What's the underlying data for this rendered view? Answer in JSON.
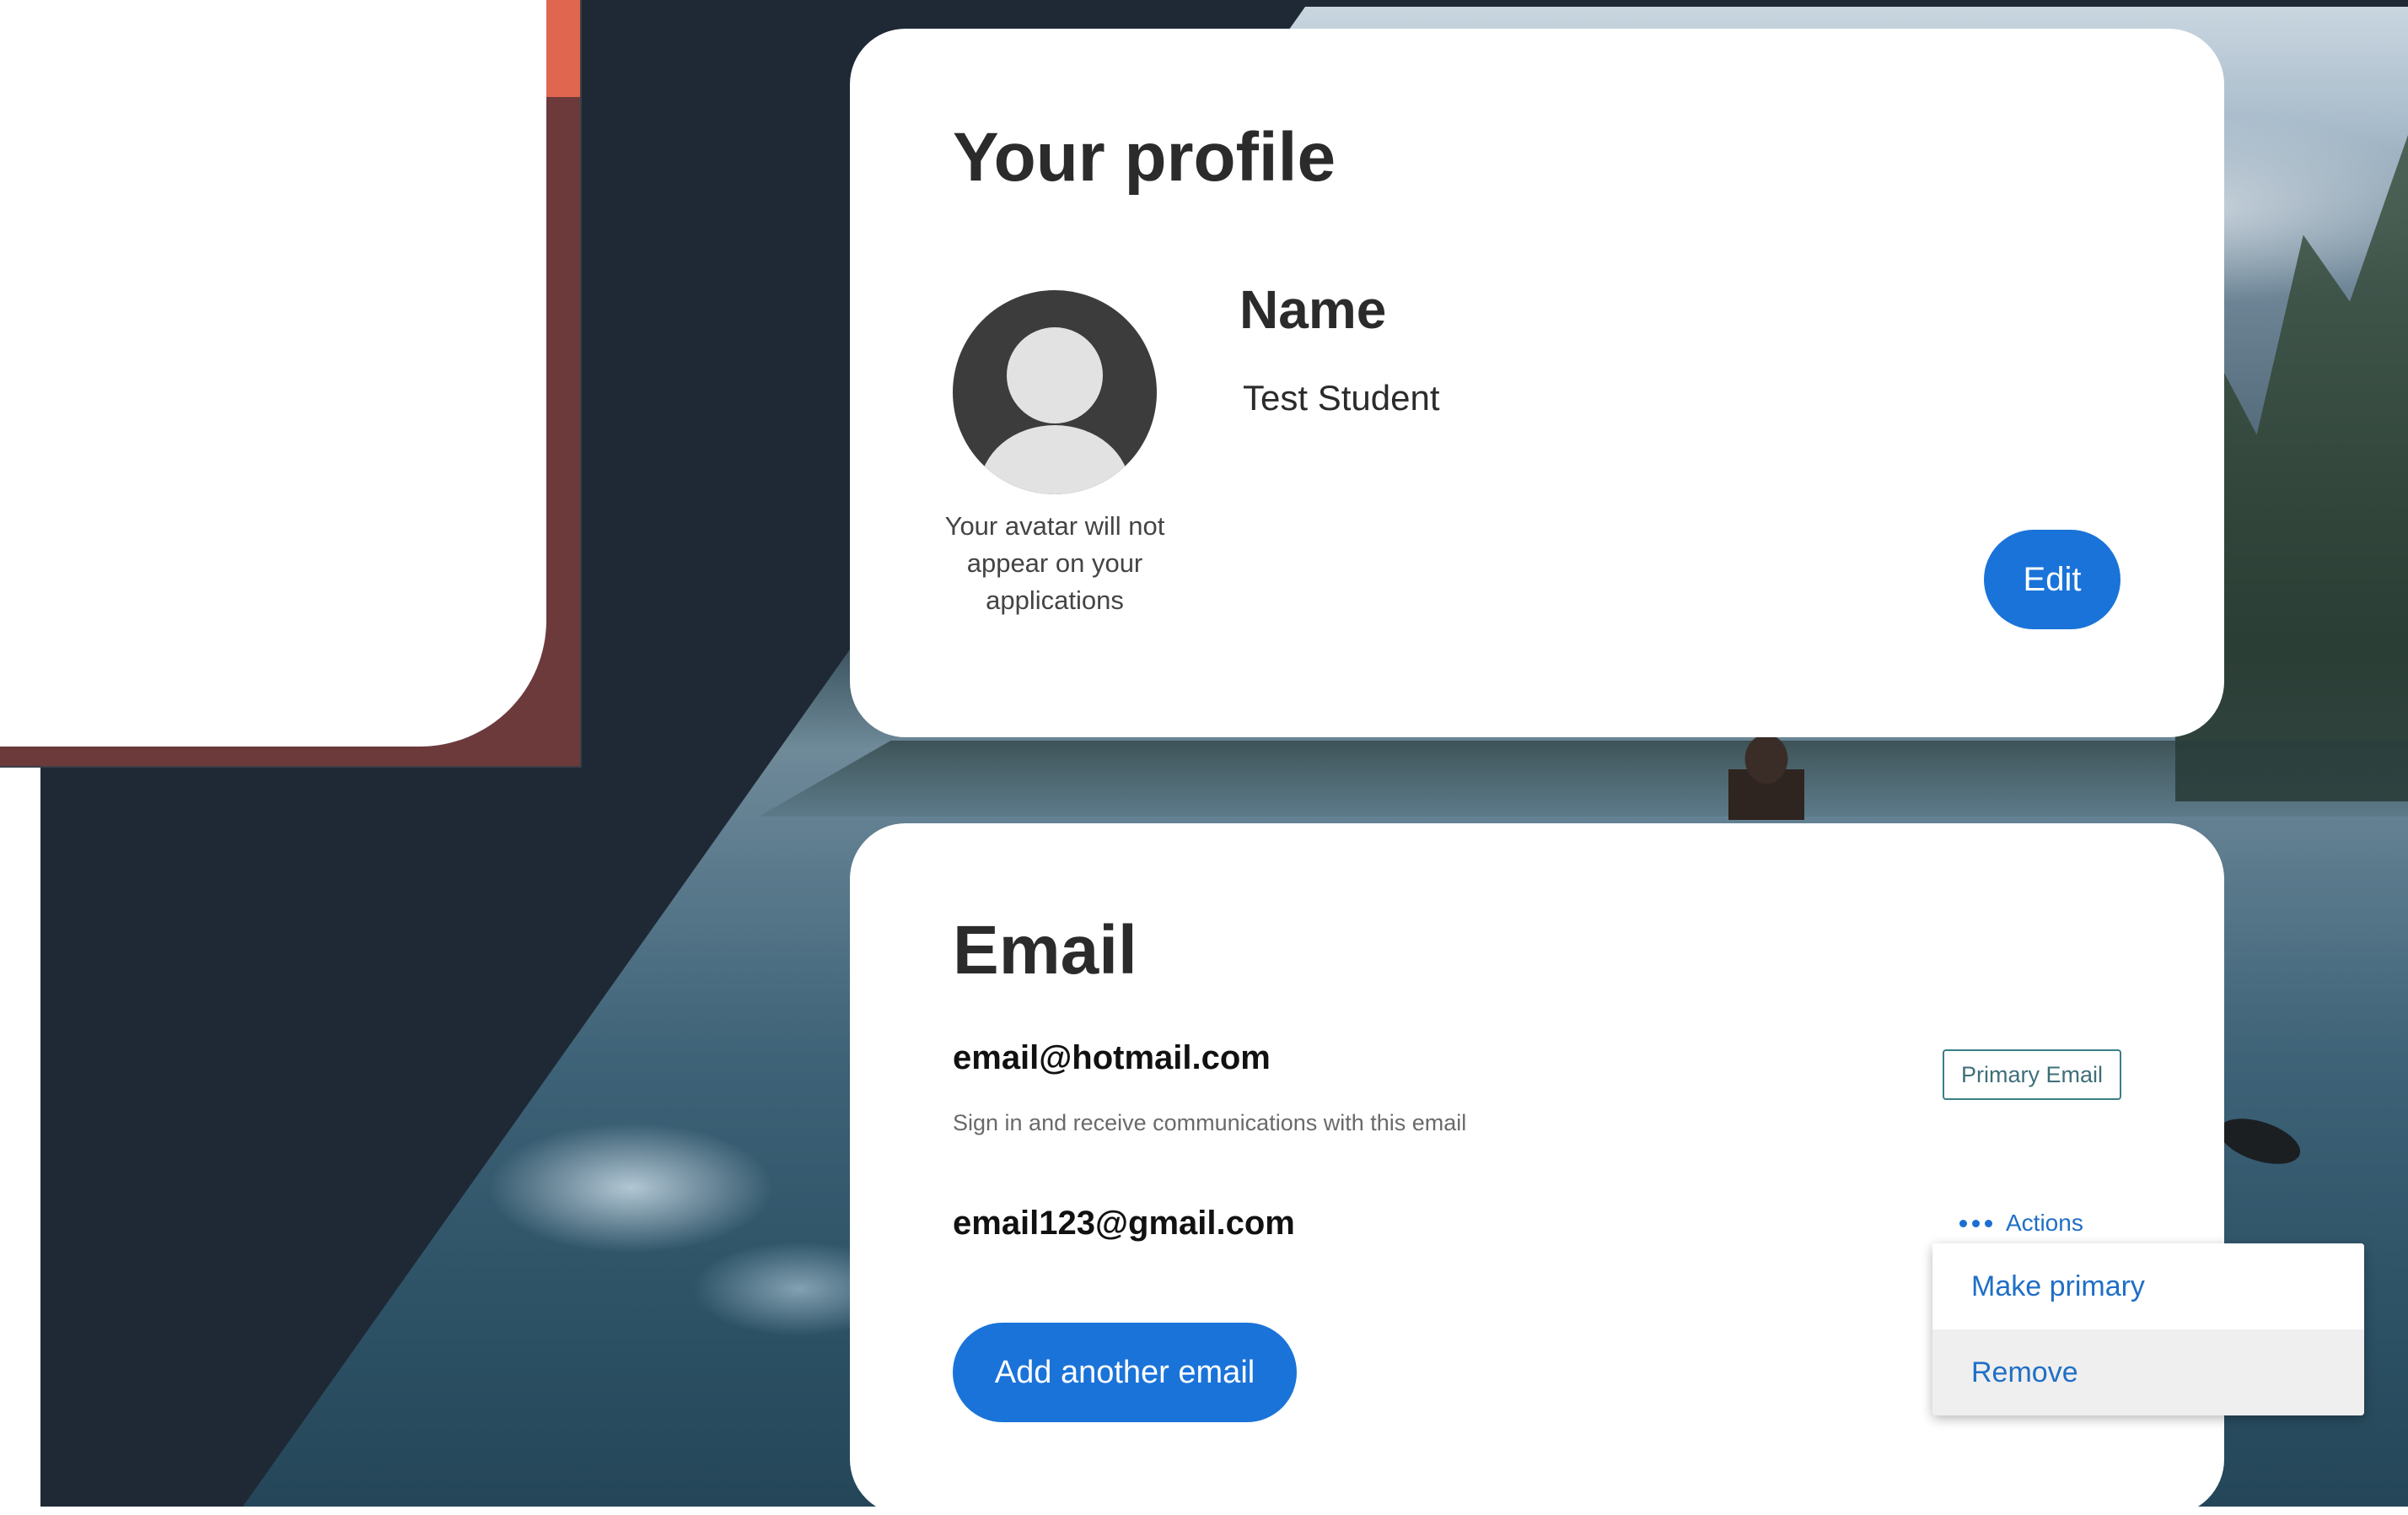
{
  "profile": {
    "title": "Your profile",
    "avatar_note": "Your avatar will not appear on your applications",
    "name_label": "Name",
    "name_value": "Test Student",
    "edit_label": "Edit"
  },
  "email": {
    "title": "Email",
    "addresses": [
      {
        "address": "email@hotmail.com",
        "badge": "Primary Email",
        "description": "Sign in and receive communications with this email"
      },
      {
        "address": "email123@gmail.com",
        "actions_label": "Actions"
      }
    ],
    "add_label": "Add another email"
  },
  "actions_menu": {
    "items": [
      {
        "label": "Make primary"
      },
      {
        "label": "Remove"
      }
    ]
  },
  "colors": {
    "accent_blue": "#1a73d9",
    "link_blue": "#1f6fc6",
    "badge_border": "#3a7e86",
    "background_dark": "#1f2935",
    "left_accent": "#e06650"
  },
  "icons": {
    "avatar": "user-avatar-placeholder-icon",
    "actions": "more-horizontal-dots-icon"
  }
}
